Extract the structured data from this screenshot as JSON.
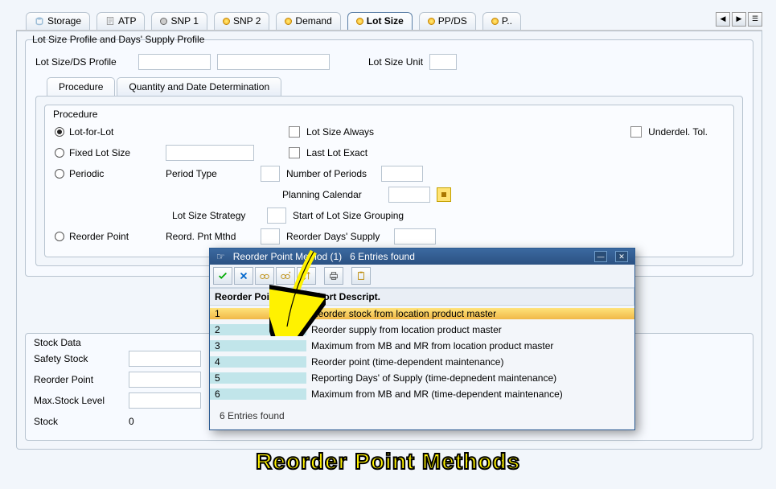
{
  "tabbar": {
    "tabs": [
      {
        "label": "Storage",
        "status": "gray"
      },
      {
        "label": "ATP",
        "status": "gray"
      },
      {
        "label": "SNP 1",
        "status": "gray"
      },
      {
        "label": "SNP 2",
        "status": "yellow"
      },
      {
        "label": "Demand",
        "status": "yellow"
      },
      {
        "label": "Lot Size",
        "status": "yellow",
        "active": true
      },
      {
        "label": "PP/DS",
        "status": "yellow"
      },
      {
        "label": "P..",
        "status": "yellow"
      }
    ]
  },
  "profile": {
    "group_title": "Lot Size Profile and Days' Supply Profile",
    "lotsize_ds_label": "Lot Size/DS Profile",
    "lot_unit_label": "Lot Size Unit"
  },
  "subtabs": {
    "procedure": "Procedure",
    "qtydate": "Quantity and Date Determination"
  },
  "procedure": {
    "title": "Procedure",
    "lot_for_lot": "Lot-for-Lot",
    "fixed": "Fixed Lot Size",
    "periodic": "Periodic",
    "period_type": "Period Type",
    "lot_size_always": "Lot Size Always",
    "last_lot_exact": "Last Lot Exact",
    "number_periods": "Number of Periods",
    "planning_calendar": "Planning Calendar",
    "underdel": "Underdel. Tol.",
    "lot_size_strategy": "Lot Size Strategy",
    "start_group": "Start of Lot Size Grouping",
    "reorder_point": "Reorder Point",
    "reord_pnt_mthd": "Reord. Pnt Mthd",
    "reorder_days": "Reorder Days' Supply"
  },
  "popup": {
    "title_prefix": "Reorder Point Method (1)",
    "entries_found": "6 Entries found",
    "col1": "Reorder Point M...",
    "col2": "Short Descript.",
    "rows": [
      {
        "n": "1",
        "desc": "Reorder stock from location product master"
      },
      {
        "n": "2",
        "desc": "Reorder supply from location product master"
      },
      {
        "n": "3",
        "desc": "Maximum from MB and MR from location product master"
      },
      {
        "n": "4",
        "desc": "Reorder point (time-dependent maintenance)"
      },
      {
        "n": "5",
        "desc": "Reporting Days' of Supply (time-depnedent maintenance)"
      },
      {
        "n": "6",
        "desc": "Maximum from MB and MR (time-dependent maintenance)"
      }
    ],
    "status": "6 Entries found"
  },
  "stock": {
    "title": "Stock Data",
    "safety": "Safety Stock",
    "reorder": "Reorder Point",
    "max": "Max.Stock Level",
    "stock_label": "Stock",
    "stock_value": "0"
  },
  "caption": "Reorder Point Methods"
}
